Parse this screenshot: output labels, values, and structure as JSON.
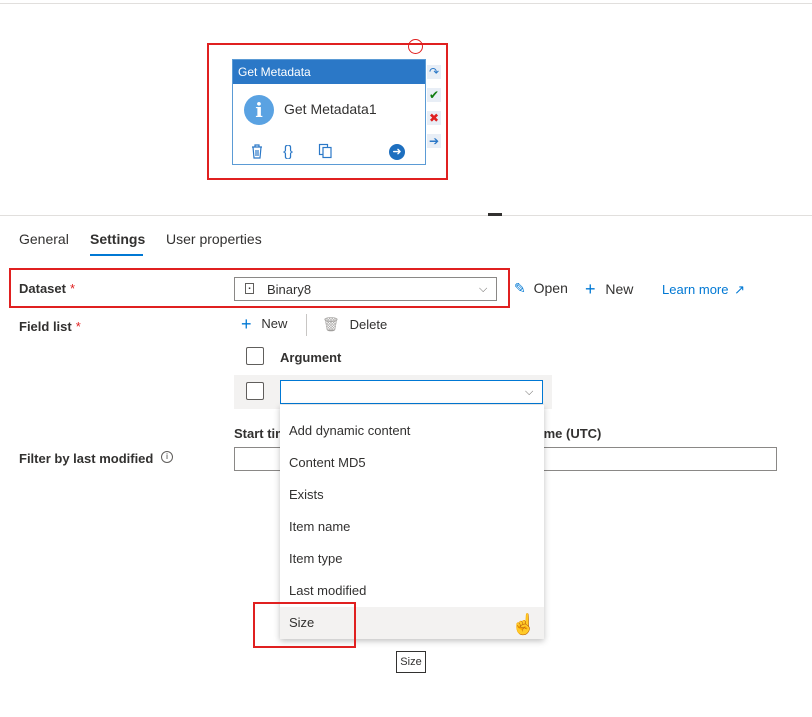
{
  "activity": {
    "type_label": "Get Metadata",
    "name": "Get Metadata1",
    "info_glyph": "i",
    "actions": [
      "delete-icon",
      "code-icon",
      "copy-icon",
      "run-icon"
    ],
    "side_tools": [
      "redo-icon",
      "success-check-icon",
      "failure-x-icon",
      "completion-arrow-icon"
    ]
  },
  "tabs": [
    {
      "label": "General",
      "active": false
    },
    {
      "label": "Settings",
      "active": true
    },
    {
      "label": "User properties",
      "active": false
    }
  ],
  "dataset": {
    "label": "Dataset",
    "required_mark": "*",
    "value": "Binary8",
    "open_label": "Open",
    "new_label": "New",
    "learn_more_label": "Learn more"
  },
  "field_list": {
    "label": "Field list",
    "required_mark": "*",
    "new_label": "New",
    "delete_label": "Delete",
    "column_header": "Argument",
    "current_value": ""
  },
  "filter": {
    "label": "Filter by last modified",
    "start_label": "Start tim",
    "end_label": "ime (UTC)"
  },
  "dropdown_options": [
    "Add dynamic content",
    "Content MD5",
    "Exists",
    "Item name",
    "Item type",
    "Last modified",
    "Size"
  ],
  "hovered_option": "Size",
  "tooltip": "Size",
  "colors": {
    "accent": "#0078d4",
    "node_header": "#2b78c7",
    "annotation_red": "#e02020"
  }
}
